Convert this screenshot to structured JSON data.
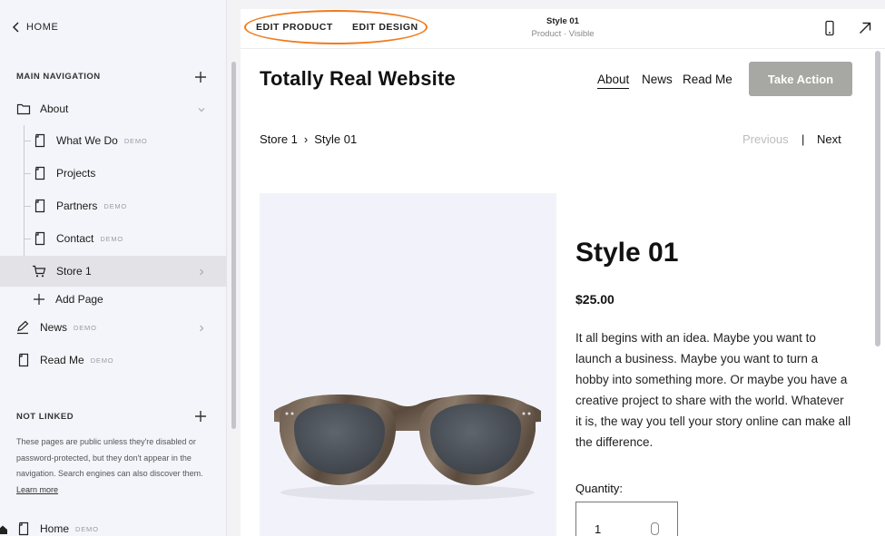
{
  "sidebar": {
    "home_label": "HOME",
    "main_nav_heading": "MAIN NAVIGATION",
    "items": [
      {
        "label": "About",
        "badge": "",
        "icon": "folder-icon"
      },
      {
        "label": "What We Do",
        "badge": "DEMO",
        "icon": "page-icon"
      },
      {
        "label": "Projects",
        "badge": "",
        "icon": "page-icon"
      },
      {
        "label": "Partners",
        "badge": "DEMO",
        "icon": "page-icon"
      },
      {
        "label": "Contact",
        "badge": "DEMO",
        "icon": "page-icon"
      },
      {
        "label": "Store 1",
        "badge": "",
        "icon": "cart-icon"
      },
      {
        "label": "Add Page",
        "badge": "",
        "icon": "plus-icon"
      },
      {
        "label": "News",
        "badge": "DEMO",
        "icon": "blog-icon"
      },
      {
        "label": "Read Me",
        "badge": "DEMO",
        "icon": "page-icon"
      }
    ],
    "not_linked_heading": "NOT LINKED",
    "not_linked_text": "These pages are public unless they're disabled or password-protected, but they don't appear in the navigation. Search engines can also discover them.",
    "learn_more": "Learn more",
    "unlinked_items": [
      {
        "label": "Home",
        "badge": "DEMO",
        "icon": "page-icon"
      }
    ]
  },
  "toolbar": {
    "edit_product": "EDIT PRODUCT",
    "edit_design": "EDIT DESIGN",
    "title": "Style 01",
    "subtitle": "Product · Visible",
    "accent_color": "#f07b1d"
  },
  "site": {
    "title": "Totally Real Website",
    "nav": [
      "About",
      "News",
      "Read Me"
    ],
    "cta": "Take Action"
  },
  "breadcrumb": {
    "parent": "Store 1",
    "separator": "›",
    "current": "Style 01"
  },
  "pager": {
    "previous": "Previous",
    "separator": "|",
    "next": "Next"
  },
  "product": {
    "title": "Style 01",
    "price": "$25.00",
    "description": "It all begins with an idea. Maybe you want to launch a business. Maybe you want to turn a hobby into something more. Or maybe you have a creative project to share with the world. Whatever it is, the way you tell your story online can make all the difference.",
    "quantity_label": "Quantity:",
    "quantity_value": "1"
  }
}
